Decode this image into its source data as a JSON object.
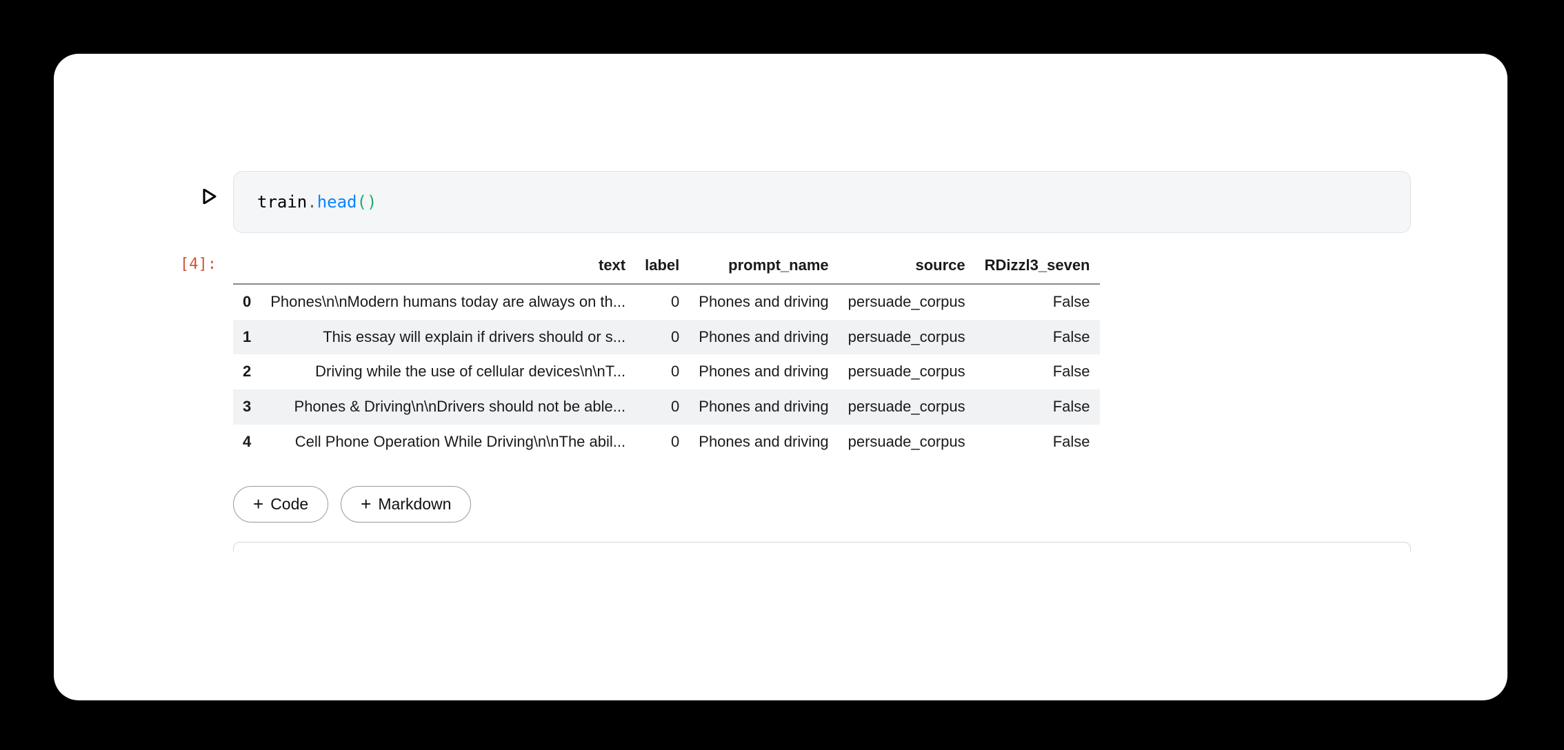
{
  "code_cell": {
    "object_name": "train",
    "dot": ".",
    "method": "head",
    "paren_open": "(",
    "paren_close": ")"
  },
  "exec_label": "[4]:",
  "table": {
    "columns": [
      "text",
      "label",
      "prompt_name",
      "source",
      "RDizzl3_seven"
    ],
    "index": [
      "0",
      "1",
      "2",
      "3",
      "4"
    ],
    "rows": [
      {
        "text": "Phones\\n\\nModern humans today are always on th...",
        "label": "0",
        "prompt_name": "Phones and driving",
        "source": "persuade_corpus",
        "rdizzl3": "False"
      },
      {
        "text": "This essay will explain if drivers should or s...",
        "label": "0",
        "prompt_name": "Phones and driving",
        "source": "persuade_corpus",
        "rdizzl3": "False"
      },
      {
        "text": "Driving while the use of cellular devices\\n\\nT...",
        "label": "0",
        "prompt_name": "Phones and driving",
        "source": "persuade_corpus",
        "rdizzl3": "False"
      },
      {
        "text": "Phones & Driving\\n\\nDrivers should not be able...",
        "label": "0",
        "prompt_name": "Phones and driving",
        "source": "persuade_corpus",
        "rdizzl3": "False"
      },
      {
        "text": "Cell Phone Operation While Driving\\n\\nThe abil...",
        "label": "0",
        "prompt_name": "Phones and driving",
        "source": "persuade_corpus",
        "rdizzl3": "False"
      }
    ]
  },
  "buttons": {
    "add_code": "Code",
    "add_markdown": "Markdown"
  }
}
